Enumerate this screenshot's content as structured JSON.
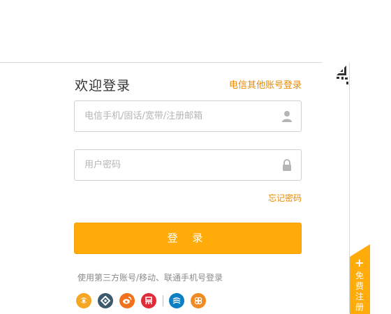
{
  "login": {
    "title": "欢迎登录",
    "other_account_link": "电信其他账号登录",
    "account_placeholder": "电信手机/固话/宽带/注册邮箱",
    "password_placeholder": "用户密码",
    "forgot_password": "忘记密码",
    "login_button": "登 录",
    "third_party_label": "使用第三方账号/移动、联通手机号登录"
  },
  "third_party_icons": [
    {
      "name": "tianyi-icon",
      "color": "#f5a623"
    },
    {
      "name": "account-icon",
      "color": "#3d5a6c"
    },
    {
      "name": "weibo-icon",
      "color": "#f2711c"
    },
    {
      "name": "yi-icon",
      "color": "#e02b3a"
    },
    {
      "name": "china-mobile-icon",
      "color": "#0a7fc4"
    },
    {
      "name": "china-unicom-icon",
      "color": "#f08a24"
    }
  ],
  "register_tab": {
    "plus": "+",
    "label": "免费注册"
  },
  "colors": {
    "accent": "#ffab0a",
    "link": "#e88a00"
  }
}
